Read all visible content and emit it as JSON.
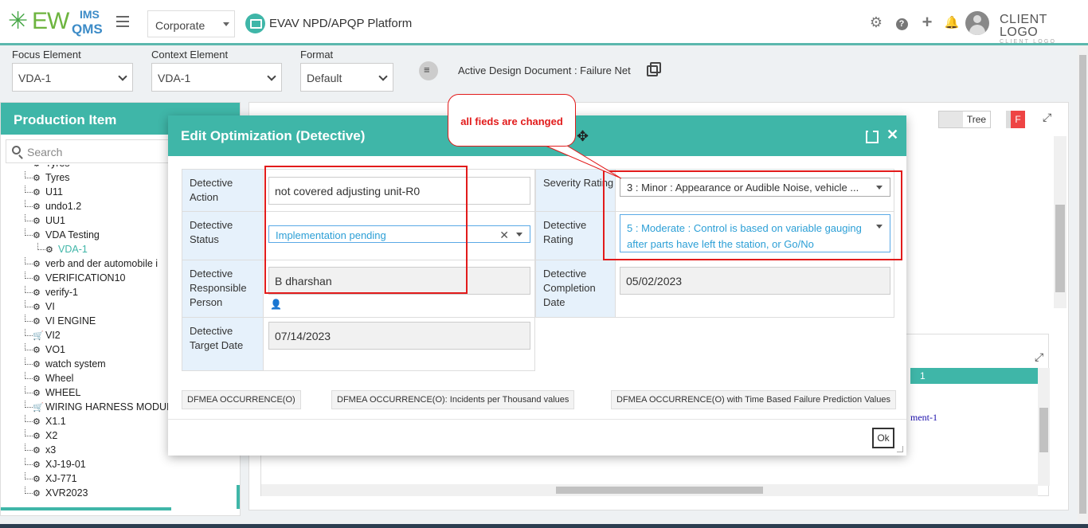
{
  "app": {
    "logo": {
      "ew": "EW",
      "ims": "IMS",
      "qms": "QMS"
    },
    "org_select": "Corporate",
    "platform_title": "EVAV NPD/APQP Platform",
    "client_logo": "CLIENT LOGO",
    "client_logo_sub": "CLIENT LOGO",
    "icons": [
      "gear-icon",
      "help-icon",
      "plus-icon",
      "bell-icon",
      "user-avatar"
    ]
  },
  "filters": {
    "focus_label": "Focus Element",
    "focus_value": "VDA-1",
    "context_label": "Context Element",
    "context_value": "VDA-1",
    "format_label": "Format",
    "format_value": "Default",
    "active_doc": "Active Design Document : Failure Net"
  },
  "left_panel": {
    "title": "Production Item",
    "search_placeholder": "Search",
    "items": [
      {
        "label": "Tyres",
        "icon": "gear-icon",
        "indent": 0
      },
      {
        "label": "U11",
        "icon": "gear-icon",
        "indent": 0
      },
      {
        "label": "undo1.2",
        "icon": "gear-icon",
        "indent": 0
      },
      {
        "label": "UU1",
        "icon": "gear-icon",
        "indent": 0
      },
      {
        "label": "VDA Testing",
        "icon": "gear-icon",
        "indent": 0
      },
      {
        "label": "VDA-1",
        "icon": "gear-icon",
        "indent": 1,
        "selected": true
      },
      {
        "label": "verb and der automobile i",
        "icon": "gear-icon",
        "indent": 0
      },
      {
        "label": "VERIFICATION10",
        "icon": "gear-icon",
        "indent": 0
      },
      {
        "label": "verify-1",
        "icon": "gear-icon",
        "indent": 0
      },
      {
        "label": "VI",
        "icon": "gear-icon",
        "indent": 0
      },
      {
        "label": "VI ENGINE",
        "icon": "gear-icon",
        "indent": 0
      },
      {
        "label": "VI2",
        "icon": "cart-icon",
        "indent": 0
      },
      {
        "label": "VO1",
        "icon": "gear-icon",
        "indent": 0
      },
      {
        "label": "watch system",
        "icon": "gear-icon",
        "indent": 0
      },
      {
        "label": "Wheel",
        "icon": "gear-icon",
        "indent": 0
      },
      {
        "label": "WHEEL",
        "icon": "gear-icon",
        "indent": 0
      },
      {
        "label": "WIRING HARNESS MODUL",
        "icon": "cart-icon",
        "indent": 0
      },
      {
        "label": "X1.1",
        "icon": "gear-icon",
        "indent": 0
      },
      {
        "label": "X2",
        "icon": "gear-icon",
        "indent": 0
      },
      {
        "label": "x3",
        "icon": "gear-icon",
        "indent": 0
      },
      {
        "label": "XJ-19-01",
        "icon": "gear-icon",
        "indent": 0
      },
      {
        "label": "XJ-771",
        "icon": "gear-icon",
        "indent": 0
      },
      {
        "label": "XVR2023",
        "icon": "gear-icon",
        "indent": 0
      }
    ],
    "partial_top_item": "Tyres"
  },
  "right_panel": {
    "tree_toggle": "Tree",
    "red_button": "F",
    "bottom_teal_text": "1",
    "bottom_link": "ment-1"
  },
  "modal": {
    "title": "Edit Optimization (Detective)",
    "fields": {
      "action_label": "Detective Action",
      "action_value": "not covered adjusting unit-R0",
      "status_label": "Detective Status",
      "status_value": "Implementation pending",
      "responsible_label": "Detective Responsible Person",
      "responsible_value": "B dharshan",
      "target_label": "Detective Target Date",
      "target_value": "07/14/2023",
      "severity_label": "Severity Rating",
      "severity_value": "3 : Minor : Appearance or Audible Noise, vehicle ...",
      "detective_rating_label": "Detective Rating",
      "detective_rating_value": "5 : Moderate : Control is based on variable gauging after parts have left the station, or Go/No",
      "completion_label": "Detective Completion Date",
      "completion_value": "05/02/2023"
    },
    "tags": [
      "DFMEA OCCURRENCE(O)",
      "DFMEA OCCURRENCE(O): Incidents per Thousand values",
      "DFMEA OCCURRENCE(O) with Time Based Failure Prediction Values"
    ],
    "ok_label": "Ok"
  },
  "annotation": {
    "callout_text": "all fieds are changed"
  }
}
